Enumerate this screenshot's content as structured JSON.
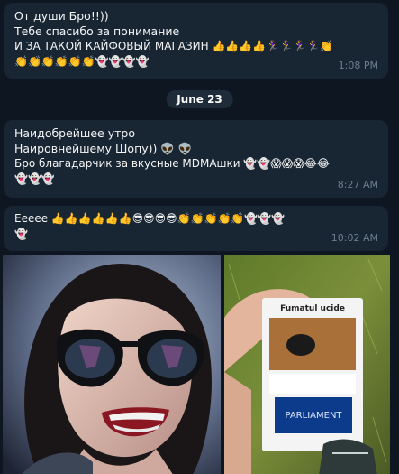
{
  "messages": [
    {
      "lines": [
        "От души Бро!!))",
        "Тебе спасибо за понимание",
        "И ЗА ТАКОЙ КАЙФОВЫЙ МАГАЗИН 👍👍👍👍🏃‍♀️🏃‍♀️🏃‍♀️🏃‍♀️👏",
        "👏👏👏👏👏👏👻👻👻👻"
      ],
      "time": "1:08 PM"
    },
    {
      "lines": [
        "Наидобрейшее утро",
        "Наировнейшему Шопу)) 👽 👽",
        "Бро благадарчик за вкусные MDMAшки 👻👻😱😱😱😂😂",
        "👻👻👻"
      ],
      "time": "8:27 AM"
    },
    {
      "lines": [
        "Еееее 👍👍👍👍👍👍😎😎😎😎👏👏👏👏👏👻👻👻",
        "👻"
      ],
      "time": "10:02 AM"
    }
  ],
  "date_separator": "June 23",
  "photos": [
    {
      "icon": "portrait-photo"
    },
    {
      "icon": "hand-holding-cigarette-pack-photo",
      "pack_text_top": "Fumatul ucide",
      "pack_text_bottom": "PARLIAMENT"
    }
  ]
}
